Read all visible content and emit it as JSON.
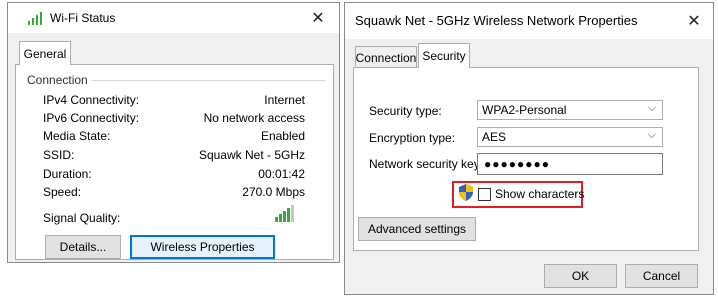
{
  "wifi_status": {
    "title": "Wi-Fi Status",
    "close_glyph": "✕",
    "tab_general": "General",
    "group_caption": "Connection",
    "rows": [
      {
        "label": "IPv4 Connectivity:",
        "value": "Internet"
      },
      {
        "label": "IPv6 Connectivity:",
        "value": "No network access"
      },
      {
        "label": "Media State:",
        "value": "Enabled"
      },
      {
        "label": "SSID:",
        "value": "Squawk Net - 5GHz"
      },
      {
        "label": "Duration:",
        "value": "00:01:42"
      },
      {
        "label": "Speed:",
        "value": "270.0 Mbps"
      }
    ],
    "signal_label": "Signal Quality:",
    "signal_bars_active": 4,
    "signal_bars_total": 5,
    "details_button": "Details...",
    "wireless_properties_button": "Wireless Properties",
    "icons": {
      "title": "wifi-signal-icon",
      "signal": "signal-bars-icon"
    }
  },
  "network_properties": {
    "title": "Squawk Net - 5GHz Wireless Network Properties",
    "close_glyph": "✕",
    "tabs": [
      {
        "label": "Connection",
        "active": false
      },
      {
        "label": "Security",
        "active": true
      }
    ],
    "security_type_label": "Security type:",
    "security_type_value": "WPA2-Personal",
    "encryption_type_label": "Encryption type:",
    "encryption_type_value": "AES",
    "key_label": "Network security key",
    "key_value": "●●●●●●●●",
    "show_characters_label": "Show characters",
    "show_characters_checked": false,
    "advanced_button": "Advanced settings",
    "ok_button": "OK",
    "cancel_button": "Cancel",
    "chevron_glyph": "⌵",
    "icons": {
      "shield": "uac-shield-icon",
      "chevron": "chevron-down-icon"
    }
  },
  "colors": {
    "signal_green": "#3aa83a",
    "signal_inactive": "#c8c8c8",
    "highlight_red": "#e02020",
    "focus_blue": "#0078d7"
  }
}
